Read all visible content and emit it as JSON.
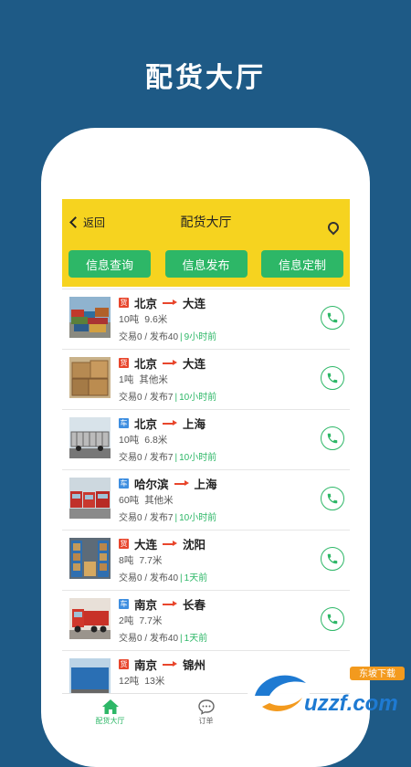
{
  "promo_title": "配货大厅",
  "nav": {
    "back_label": "返回",
    "title": "配货大厅",
    "location_icon": "location-pin-icon"
  },
  "actions": [
    {
      "label": "信息查询"
    },
    {
      "label": "信息发布"
    },
    {
      "label": "信息定制"
    }
  ],
  "listings": [
    {
      "type": "货",
      "from": "北京",
      "to": "大连",
      "weight": "10吨",
      "size": "9.6米",
      "trades": "交易0",
      "posts": "发布40",
      "time": "9小时前"
    },
    {
      "type": "货",
      "from": "北京",
      "to": "大连",
      "weight": "1吨",
      "size": "其他米",
      "trades": "交易0",
      "posts": "发布7",
      "time": "10小时前"
    },
    {
      "type": "车",
      "from": "北京",
      "to": "上海",
      "weight": "10吨",
      "size": "6.8米",
      "trades": "交易0",
      "posts": "发布7",
      "time": "10小时前"
    },
    {
      "type": "车",
      "from": "哈尔滨",
      "to": "上海",
      "weight": "60吨",
      "size": "其他米",
      "trades": "交易0",
      "posts": "发布7",
      "time": "10小时前"
    },
    {
      "type": "货",
      "from": "大连",
      "to": "沈阳",
      "weight": "8吨",
      "size": "7.7米",
      "trades": "交易0",
      "posts": "发布40",
      "time": "1天前"
    },
    {
      "type": "车",
      "from": "南京",
      "to": "长春",
      "weight": "2吨",
      "size": "7.7米",
      "trades": "交易0",
      "posts": "发布40",
      "time": "1天前"
    },
    {
      "type": "货",
      "from": "南京",
      "to": "锦州",
      "weight": "12吨",
      "size": "13米",
      "trades": "",
      "posts": "",
      "time": ""
    }
  ],
  "tabs": [
    {
      "label": "配货大厅",
      "active": true
    },
    {
      "label": "订单",
      "active": false
    }
  ],
  "watermark": {
    "text": "uzzf.com",
    "badge": "东坡下载"
  },
  "colors": {
    "bg": "#1e5a86",
    "accent_yellow": "#f6d31f",
    "accent_green": "#2db767",
    "tag_red": "#e8462c",
    "tag_blue": "#3e8ee0"
  }
}
